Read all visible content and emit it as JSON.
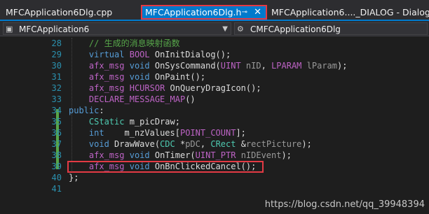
{
  "tabs": {
    "tab1_label": "MFCApplication6Dlg.cpp",
    "tab2_label": "MFCApplication6Dlg.h",
    "tab2_pin": "⊸",
    "tab2_close": "✕",
    "tab3_label": "MFCApplication6...._DIALOG - Dialog"
  },
  "nav": {
    "project_label": "MFCApplication6",
    "class_label": "CMFCApplication6Dlg"
  },
  "line_numbers": [
    "28",
    "29",
    "30",
    "31",
    "32",
    "33",
    "34",
    "35",
    "36",
    "37",
    "38",
    "39",
    "40",
    "41"
  ],
  "colors": {
    "keyword": "#569cd6",
    "type": "#4ec9b0",
    "macro": "#bd63c5",
    "comment": "#57a64a",
    "param": "#9a9a9a",
    "text": "#dcdcdc"
  },
  "code_lines": [
    [
      {
        "t": "    // 生成的消息映射函数",
        "c": "comment"
      }
    ],
    [
      {
        "t": "    ",
        "c": "text"
      },
      {
        "t": "virtual",
        "c": "keyword"
      },
      {
        "t": " ",
        "c": "text"
      },
      {
        "t": "BOOL",
        "c": "macro"
      },
      {
        "t": " OnInitDialog();",
        "c": "text"
      }
    ],
    [
      {
        "t": "    ",
        "c": "text"
      },
      {
        "t": "afx_msg",
        "c": "macro"
      },
      {
        "t": " ",
        "c": "text"
      },
      {
        "t": "void",
        "c": "keyword"
      },
      {
        "t": " OnSysCommand(",
        "c": "text"
      },
      {
        "t": "UINT",
        "c": "macro"
      },
      {
        "t": " ",
        "c": "text"
      },
      {
        "t": "nID",
        "c": "param"
      },
      {
        "t": ", ",
        "c": "text"
      },
      {
        "t": "LPARAM",
        "c": "macro"
      },
      {
        "t": " ",
        "c": "text"
      },
      {
        "t": "lParam",
        "c": "param"
      },
      {
        "t": ");",
        "c": "text"
      }
    ],
    [
      {
        "t": "    ",
        "c": "text"
      },
      {
        "t": "afx_msg",
        "c": "macro"
      },
      {
        "t": " ",
        "c": "text"
      },
      {
        "t": "void",
        "c": "keyword"
      },
      {
        "t": " OnPaint();",
        "c": "text"
      }
    ],
    [
      {
        "t": "    ",
        "c": "text"
      },
      {
        "t": "afx_msg",
        "c": "macro"
      },
      {
        "t": " ",
        "c": "text"
      },
      {
        "t": "HCURSOR",
        "c": "macro"
      },
      {
        "t": " OnQueryDragIcon();",
        "c": "text"
      }
    ],
    [
      {
        "t": "    ",
        "c": "text"
      },
      {
        "t": "DECLARE_MESSAGE_MAP",
        "c": "macro"
      },
      {
        "t": "()",
        "c": "text"
      }
    ],
    [
      {
        "t": "public",
        "c": "keyword"
      },
      {
        "t": ":",
        "c": "text"
      }
    ],
    [
      {
        "t": "    ",
        "c": "text"
      },
      {
        "t": "CStatic",
        "c": "type"
      },
      {
        "t": " m_picDraw;",
        "c": "text"
      }
    ],
    [
      {
        "t": "    ",
        "c": "text"
      },
      {
        "t": "int",
        "c": "keyword"
      },
      {
        "t": "    m_nzValues[",
        "c": "text"
      },
      {
        "t": "POINT_COUNT",
        "c": "macro"
      },
      {
        "t": "];",
        "c": "text"
      }
    ],
    [
      {
        "t": "    ",
        "c": "text"
      },
      {
        "t": "void",
        "c": "keyword"
      },
      {
        "t": " DrawWave(",
        "c": "text"
      },
      {
        "t": "CDC",
        "c": "type"
      },
      {
        "t": " *",
        "c": "text"
      },
      {
        "t": "pDC",
        "c": "param"
      },
      {
        "t": ", ",
        "c": "text"
      },
      {
        "t": "CRect",
        "c": "type"
      },
      {
        "t": " &",
        "c": "text"
      },
      {
        "t": "rectPicture",
        "c": "param"
      },
      {
        "t": ");",
        "c": "text"
      }
    ],
    [
      {
        "t": "    ",
        "c": "text"
      },
      {
        "t": "afx_msg",
        "c": "macro"
      },
      {
        "t": " ",
        "c": "text"
      },
      {
        "t": "void",
        "c": "keyword"
      },
      {
        "t": " OnTimer(",
        "c": "text"
      },
      {
        "t": "UINT_PTR",
        "c": "macro"
      },
      {
        "t": " ",
        "c": "text"
      },
      {
        "t": "nIDEvent",
        "c": "param"
      },
      {
        "t": ");",
        "c": "text"
      }
    ],
    [
      {
        "t": "    ",
        "c": "text"
      },
      {
        "t": "afx_msg",
        "c": "macro"
      },
      {
        "t": " ",
        "c": "text"
      },
      {
        "t": "void",
        "c": "keyword"
      },
      {
        "t": " OnBnClickedCancel();",
        "c": "text"
      }
    ],
    [
      {
        "t": "};",
        "c": "text"
      }
    ],
    [
      {
        "t": "",
        "c": "text"
      }
    ]
  ],
  "watermark": "https://blog.csdn.net/qq_39948394"
}
